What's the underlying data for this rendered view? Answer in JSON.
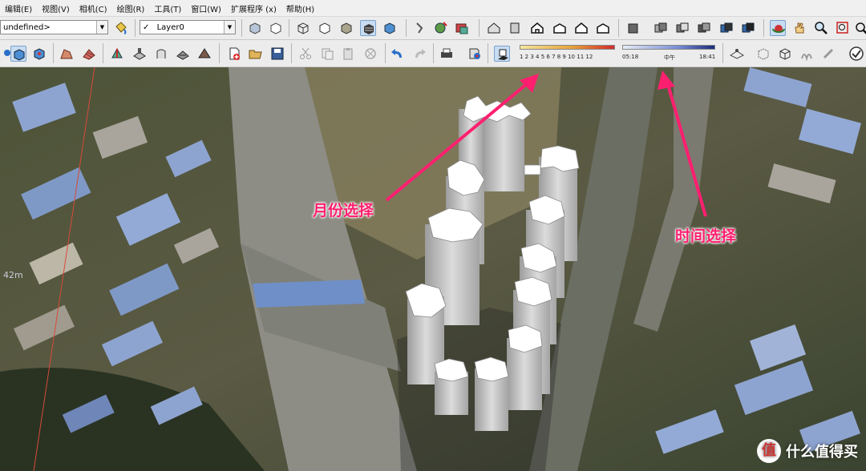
{
  "menu": [
    "编辑(E)",
    "视图(V)",
    "相机(C)",
    "绘图(R)",
    "工具(T)",
    "窗口(W)",
    "扩展程序 (x)",
    "帮助(H)"
  ],
  "toolbar": {
    "style_dropdown": "undefined>",
    "layer_dropdown": "Layer0",
    "layer_check": "✓"
  },
  "shadow_settings": {
    "month_labels": "1 2 3 4 5 6 7 8 9 10 11 12",
    "time_start": "05:18",
    "time_mid": "中午",
    "time_end": "18:41"
  },
  "viewport": {
    "scale_label": "42m"
  },
  "annotations": {
    "month_select": "月份选择",
    "time_select": "时间选择",
    "color": "#ff1f6f"
  },
  "watermark": {
    "logo": "值",
    "text": "什么值得买"
  }
}
